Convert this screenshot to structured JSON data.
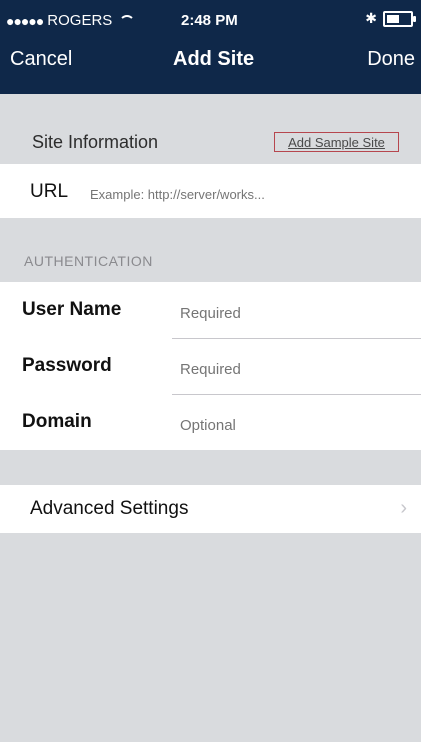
{
  "status_bar": {
    "carrier_dots": "●●●●●",
    "carrier": "ROGERS",
    "time": "2:48 PM",
    "bluetooth": "✱"
  },
  "nav": {
    "cancel_label": "Cancel",
    "title": "Add Site",
    "done_label": "Done"
  },
  "site_section": {
    "header": "Site Information",
    "sample_button": "Add Sample Site",
    "url_label": "URL",
    "url_placeholder": "Example: http://server/works..."
  },
  "auth_section": {
    "header": "AUTHENTICATION",
    "fields": [
      {
        "label": "User Name",
        "placeholder": "Required"
      },
      {
        "label": "Password",
        "placeholder": "Required"
      },
      {
        "label": "Domain",
        "placeholder": "Optional"
      }
    ]
  },
  "advanced": {
    "label": "Advanced Settings",
    "chevron": "›"
  },
  "colors": {
    "navbar": "#0f2849",
    "background": "#d9dbde",
    "accent_border": "#b6464e"
  }
}
